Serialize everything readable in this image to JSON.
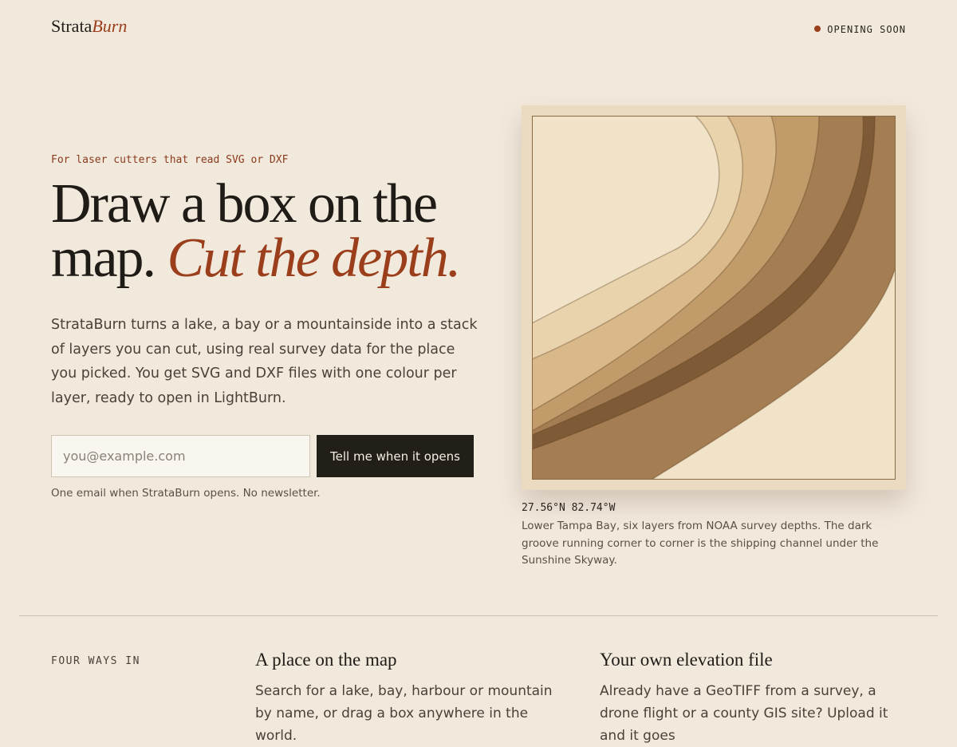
{
  "header": {
    "logo_main": "Strata",
    "logo_accent": "Burn",
    "status": "OPENING SOON"
  },
  "hero": {
    "eyebrow": "For laser cutters that read SVG or DXF",
    "headline_plain": "Draw a box on the map.",
    "headline_em": "Cut the depth.",
    "lede": "StrataBurn turns a lake, a bay or a mountainside into a stack of layers you can cut, using real survey data for the place you picked. You get SVG and DXF files with one colour per layer, ready to open in LightBurn.",
    "email_placeholder": "you@example.com",
    "cta_label": "Tell me when it opens",
    "note": "One email when StrataBurn opens. No newsletter."
  },
  "figure": {
    "coords": "27.56°N 82.74°W",
    "caption": "Lower Tampa Bay, six layers from NOAA survey depths. The dark groove running corner to corner is the shipping channel under the Sunshine Skyway.",
    "layer_colors": [
      "#f1e3c8",
      "#e8d3ad",
      "#d9b98a",
      "#c29b6a",
      "#a57d53",
      "#7e5a37"
    ]
  },
  "ways": {
    "label": "FOUR WAYS IN",
    "items": [
      {
        "title": "A place on the map",
        "body": "Search for a lake, bay, harbour or mountain by name, or drag a box anywhere in the world."
      },
      {
        "title": "Your own elevation file",
        "body": "Already have a GeoTIFF from a survey, a drone flight or a county GIS site? Upload it and it goes"
      }
    ]
  }
}
